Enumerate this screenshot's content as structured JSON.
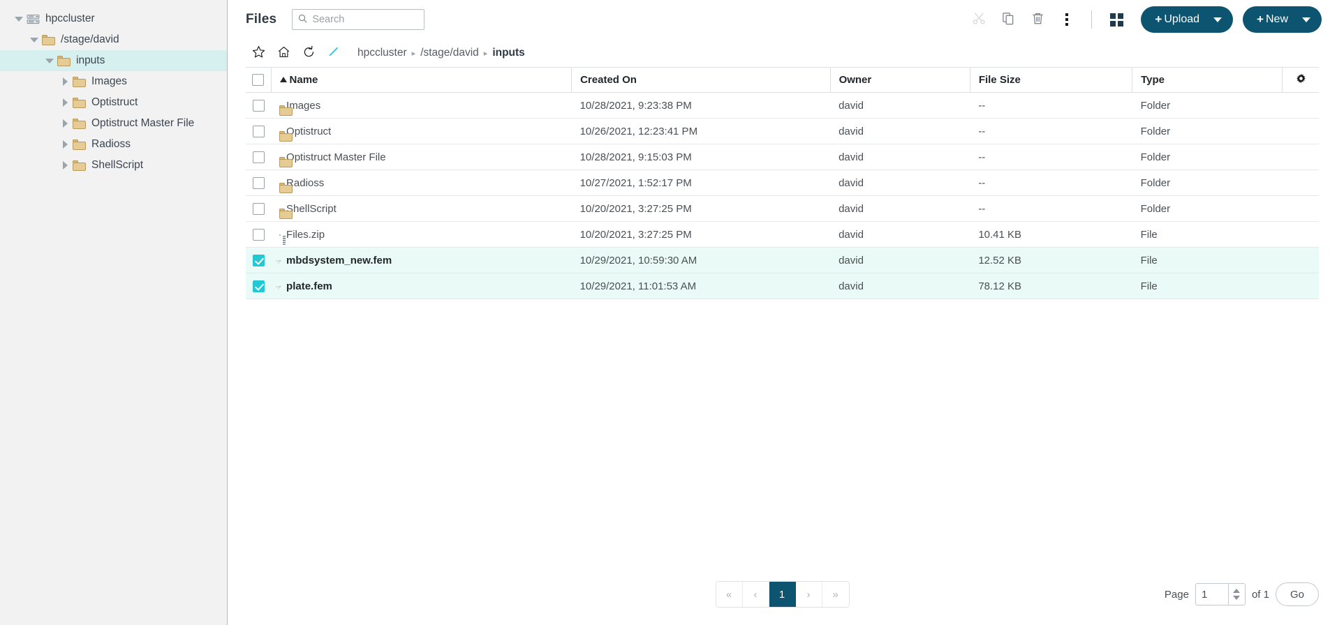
{
  "sidebar": {
    "nodes": [
      {
        "label": "hpccluster",
        "depth": 0,
        "icon": "server-icon",
        "expanded": true,
        "caret": "down",
        "selected": false
      },
      {
        "label": "/stage/david",
        "depth": 1,
        "icon": "folder-icon",
        "expanded": true,
        "caret": "down",
        "selected": false
      },
      {
        "label": "inputs",
        "depth": 2,
        "icon": "folder-icon",
        "expanded": true,
        "caret": "down",
        "selected": true
      },
      {
        "label": "Images",
        "depth": 3,
        "icon": "folder-icon",
        "expanded": false,
        "caret": "right",
        "selected": false
      },
      {
        "label": "Optistruct",
        "depth": 3,
        "icon": "folder-icon",
        "expanded": false,
        "caret": "right",
        "selected": false
      },
      {
        "label": "Optistruct Master File",
        "depth": 3,
        "icon": "folder-icon",
        "expanded": false,
        "caret": "right",
        "selected": false
      },
      {
        "label": "Radioss",
        "depth": 3,
        "icon": "folder-icon",
        "expanded": false,
        "caret": "right",
        "selected": false
      },
      {
        "label": "ShellScript",
        "depth": 3,
        "icon": "folder-icon",
        "expanded": false,
        "caret": "right",
        "selected": false
      }
    ]
  },
  "header": {
    "title": "Files",
    "search_placeholder": "Search",
    "search_value": "",
    "upload_label": "Upload",
    "upload_plus": "+",
    "new_label": "New",
    "new_plus": "+"
  },
  "breadcrumb": {
    "items": [
      "hpccluster",
      "/stage/david",
      "inputs"
    ],
    "separator": "▸"
  },
  "table": {
    "columns": [
      "Name",
      "Created On",
      "Owner",
      "File Size",
      "Type"
    ],
    "sort_column": "Name",
    "sort_direction": "asc",
    "header_checked": false,
    "rows": [
      {
        "name": "Images",
        "created_on": "10/28/2021, 9:23:38 PM",
        "owner": "david",
        "size": "--",
        "type": "Folder",
        "icon": "folder-icon",
        "checked": false
      },
      {
        "name": "Optistruct",
        "created_on": "10/26/2021, 12:23:41 PM",
        "owner": "david",
        "size": "--",
        "type": "Folder",
        "icon": "folder-icon",
        "checked": false
      },
      {
        "name": "Optistruct Master File",
        "created_on": "10/28/2021, 9:15:03 PM",
        "owner": "david",
        "size": "--",
        "type": "Folder",
        "icon": "folder-icon",
        "checked": false
      },
      {
        "name": "Radioss",
        "created_on": "10/27/2021, 1:52:17 PM",
        "owner": "david",
        "size": "--",
        "type": "Folder",
        "icon": "folder-icon",
        "checked": false
      },
      {
        "name": "ShellScript",
        "created_on": "10/20/2021, 3:27:25 PM",
        "owner": "david",
        "size": "--",
        "type": "Folder",
        "icon": "folder-icon",
        "checked": false
      },
      {
        "name": "Files.zip",
        "created_on": "10/20/2021, 3:27:25 PM",
        "owner": "david",
        "size": "10.41 KB",
        "type": "File",
        "icon": "zip-icon",
        "checked": false
      },
      {
        "name": "mbdsystem_new.fem",
        "created_on": "10/29/2021, 10:59:30 AM",
        "owner": "david",
        "size": "12.52 KB",
        "type": "File",
        "icon": "file-icon",
        "checked": true
      },
      {
        "name": "plate.fem",
        "created_on": "10/29/2021, 11:01:53 AM",
        "owner": "david",
        "size": "78.12 KB",
        "type": "File",
        "icon": "file-icon",
        "checked": true
      }
    ]
  },
  "pagination": {
    "first_label": "«",
    "prev_label": "‹",
    "current_page": "1",
    "next_label": "›",
    "last_label": "»",
    "page_label": "Page",
    "page_input_value": "1",
    "of_label": "of 1",
    "go_label": "Go"
  },
  "colors": {
    "accent": "#0c5470",
    "checkbox_checked": "#22c8d4",
    "selected_row": "#eafaf7",
    "sidebar_selected": "#d6f0f0",
    "sidebar_bg": "#f2f2f2"
  }
}
